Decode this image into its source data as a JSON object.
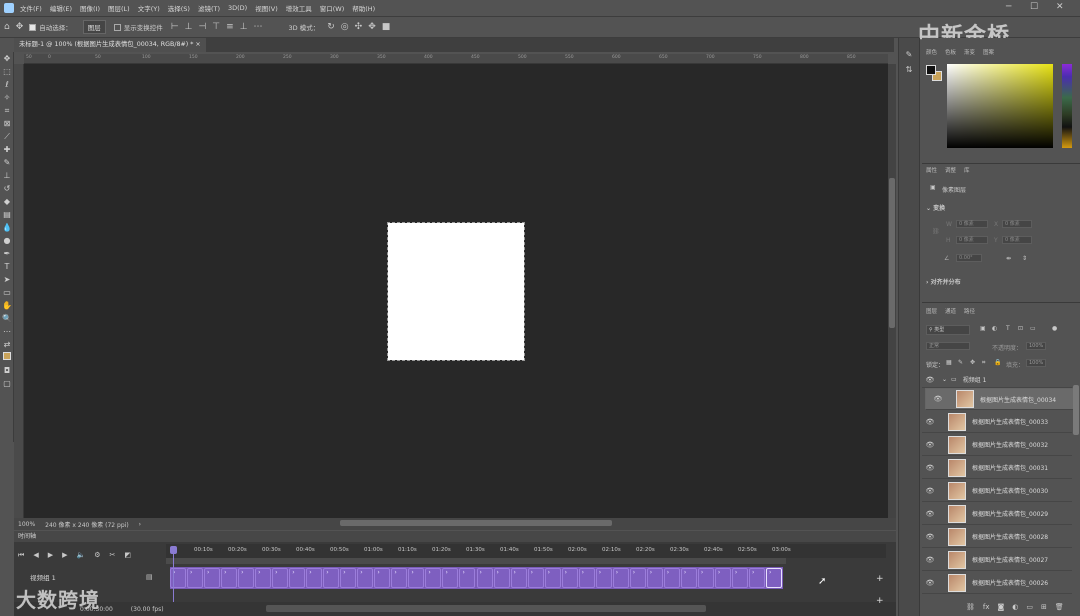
{
  "menu": [
    "文件(F)",
    "编辑(E)",
    "图像(I)",
    "图层(L)",
    "文字(Y)",
    "选择(S)",
    "滤镜(T)",
    "3D(D)",
    "视图(V)",
    "增效工具",
    "窗口(W)",
    "帮助(H)"
  ],
  "options": {
    "auto_select_label": "自动选择：",
    "auto_select_value": "图层",
    "show_transform": "显示变换控件",
    "mode_3d": "3D 模式："
  },
  "document_tab": "未标题-1 @ 100% (根据图片生成表情包_00034, RGB/8#) *",
  "ruler_ticks": [
    "50",
    "0",
    "50",
    "100",
    "150",
    "200",
    "250",
    "300",
    "350",
    "400",
    "450",
    "500",
    "550",
    "600",
    "650",
    "700",
    "750",
    "800",
    "850"
  ],
  "status": {
    "zoom": "100%",
    "doc_size": "240 像素 x 240 像素 (72 ppi)"
  },
  "timeline": {
    "panel_title": "时间轴",
    "times": [
      "00:10s",
      "00:20s",
      "00:30s",
      "00:40s",
      "00:50s",
      "01:00s",
      "01:10s",
      "01:20s",
      "01:30s",
      "01:40s",
      "01:50s",
      "02:00s",
      "02:10s",
      "02:20s",
      "02:30s",
      "02:40s",
      "02:50s",
      "03:00s"
    ],
    "track_label": "视频组 1",
    "timecode": "0:00:30:00",
    "fps": "(30.00 fps)",
    "clip_count": 36
  },
  "watermarks": {
    "top_right": "中新金桥",
    "bottom_left": "大数跨境"
  },
  "color_panel": {
    "tabs": [
      "颜色",
      "色板",
      "渐变",
      "图案"
    ],
    "foreground": "#111111",
    "background": "#c9a35a",
    "picker_hue": "#e7e214"
  },
  "properties": {
    "tabs": [
      "属性",
      "调整",
      "库"
    ],
    "kind": "像素图层",
    "transform": "变换",
    "w_label": "W",
    "h_label": "H",
    "x_label": "X",
    "y_label": "Y",
    "w_value": "0 像素",
    "h_value": "0 像素",
    "x_value": "0 像素",
    "y_value": "0 像素",
    "angle_value": "0.00°",
    "align": "对齐并分布"
  },
  "layers": {
    "tabs": [
      "图层",
      "通道",
      "路径"
    ],
    "filter_kind": "类型",
    "blend": "正常",
    "opacity_label": "不透明度：",
    "opacity": "100%",
    "lock_label": "锁定：",
    "fill_label": "填充：",
    "fill": "100%",
    "group": "视频组 1",
    "items": [
      "根据图片生成表情包_00034",
      "根据图片生成表情包_00033",
      "根据图片生成表情包_00032",
      "根据图片生成表情包_00031",
      "根据图片生成表情包_00030",
      "根据图片生成表情包_00029",
      "根据图片生成表情包_00028",
      "根据图片生成表情包_00027",
      "根据图片生成表情包_00026"
    ],
    "footer_icons": [
      "link-icon",
      "fx-icon",
      "mask-icon",
      "adjustment-icon",
      "group-icon",
      "new-layer-icon",
      "trash-icon"
    ]
  }
}
